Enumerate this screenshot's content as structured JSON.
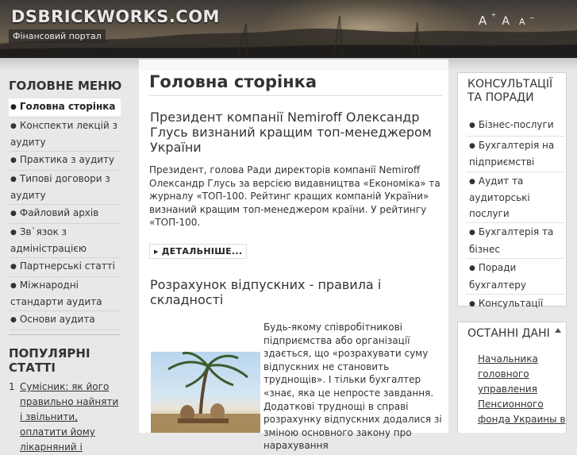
{
  "header": {
    "site_title": "DSBRICKWORKS.COM",
    "site_subtitle": "Фінансовий портал",
    "font_sizes": [
      "A",
      "A",
      "A"
    ],
    "font_size_marks": [
      "+",
      "−"
    ]
  },
  "left_menu": {
    "title": "ГОЛОВНЕ МЕНЮ",
    "items": [
      {
        "label": "Головна сторінка",
        "active": true
      },
      {
        "label": "Конспекти лекцій з аудиту",
        "active": false
      },
      {
        "label": "Практика з аудиту",
        "active": false
      },
      {
        "label": "Типові договори з аудиту",
        "active": false
      },
      {
        "label": "Файловий архів",
        "active": false
      },
      {
        "label": "Зв`язок з адміністрацією",
        "active": false
      },
      {
        "label": "Партнерські статті",
        "active": false
      },
      {
        "label": "Міжнародні стандарти аудита",
        "active": false
      },
      {
        "label": "Основи аудита",
        "active": false
      }
    ]
  },
  "popular": {
    "title": "ПОПУЛЯРНІ СТАТТІ",
    "items": [
      {
        "num": "1",
        "label": "Сумісник: як його правильно найняти і звільнити, оплатити йому лікарняний і"
      }
    ]
  },
  "main": {
    "page_title": "Головна сторінка",
    "articles": [
      {
        "title": "Президент компанії Nemiroff Олександр Глусь визнаний кращим топ-менеджером України",
        "text": "Президент, голова Ради директорів компанії  Nemiroff Олександр Глусь за версією видавництва «Економіка» та журналу «ТОП-100. Рейтинг кращих компаній України» визнаний кращим топ-менеджером країни. У рейтингу «ТОП-100.",
        "more_label": "ДЕТАЛЬНІШЕ..."
      },
      {
        "title": "Розрахунок відпускних - правила і складності",
        "text": "Будь-якому співробітникові підприємства або організації здається, що «розрахувати суму відпускних не становить труднощів». І тільки бухгалтер «знає, яка це непросте завдання. Додаткові труднощі в справі розрахунку відпускних додалися зі зміною основного закону про нарахування"
      }
    ]
  },
  "right": {
    "consult": {
      "title": "КОНСУЛЬТАЦІЇ ТА ПОРАДИ",
      "items": [
        "Бізнес-послуги",
        "Бухгалтерія на підприємстві",
        "Аудит та аудиторські послуги",
        "Бухгалтерія та бізнес",
        "Поради бухгалтеру",
        "Консультації"
      ]
    },
    "latest": {
      "title": "ОСТАННІ ДАНІ",
      "news": "Начальника головного управления Пенсионного фонда Украины в"
    }
  },
  "colors": {
    "background": "#e8e8e8",
    "content": "#ffffff",
    "text": "#333333"
  }
}
